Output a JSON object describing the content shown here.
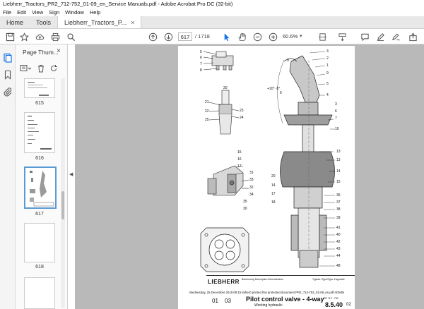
{
  "window": {
    "title": "Liebherr_Tractors_PR2_712-752_01-09_en_Service Manuals.pdf - Adobe Acrobat Pro DC (32-bit)"
  },
  "menu": [
    "File",
    "Edit",
    "View",
    "Sign",
    "Window",
    "Help"
  ],
  "tabs": {
    "home": "Home",
    "tools": "Tools",
    "document": "Liebherr_Tractors_P...",
    "close": "×"
  },
  "toolbar": {
    "page_current": "617",
    "page_total": "/ 1718",
    "zoom": "60.6%",
    "zoom_caret": "▾"
  },
  "panel": {
    "title": "Page Thum...",
    "close": "×",
    "thumbs": [
      {
        "label": "615"
      },
      {
        "label": "616"
      },
      {
        "label": "617"
      },
      {
        "label": "618"
      }
    ]
  },
  "drawing": {
    "callouts_top_left": [
      "5",
      "6",
      "7",
      "8"
    ],
    "callouts_mid_left": [
      "20",
      "21",
      "22",
      "23",
      "24",
      "25"
    ],
    "callouts_right": [
      "3",
      "2",
      "1",
      "9",
      "5",
      "4",
      "3",
      "6",
      "7",
      "8",
      "10",
      "11",
      "12",
      "13",
      "13",
      "14",
      "15",
      "36",
      "37",
      "38",
      "39",
      "41",
      "40",
      "42",
      "43",
      "44",
      "45",
      "46",
      "47",
      "48"
    ],
    "callouts_lower_left": [
      "15",
      "16",
      "17",
      "31",
      "33",
      "32",
      "34",
      "35",
      "30",
      "28",
      "29",
      "26",
      "27",
      "20",
      "14",
      "17",
      "18"
    ],
    "side_note": "+10° -5°",
    "callout_6": "6",
    "callout_9": "9"
  },
  "title_block": {
    "brand": "LIEBHERR",
    "header_left": "Benennung  Description  Dénomination",
    "header_right": "Typbez./Type/Type d'appareil",
    "print_line": "Wednesday, 25 December 2019 08:15 lether0 printed this protected document PR2_712-752_01-09_en.pdf ADMIN",
    "doc_no_a": "01",
    "doc_no_b": "03",
    "title": "Pilot control valve - 4-way",
    "subtitle": "Working hydraulic",
    "section": "8.5.40",
    "section_suffix": "02",
    "small_right": "PR 712 - 752"
  },
  "colors": {
    "accent": "#1473e6",
    "viewer_bg": "#b9b9b9",
    "tab_bg": "#e8e8e8"
  }
}
